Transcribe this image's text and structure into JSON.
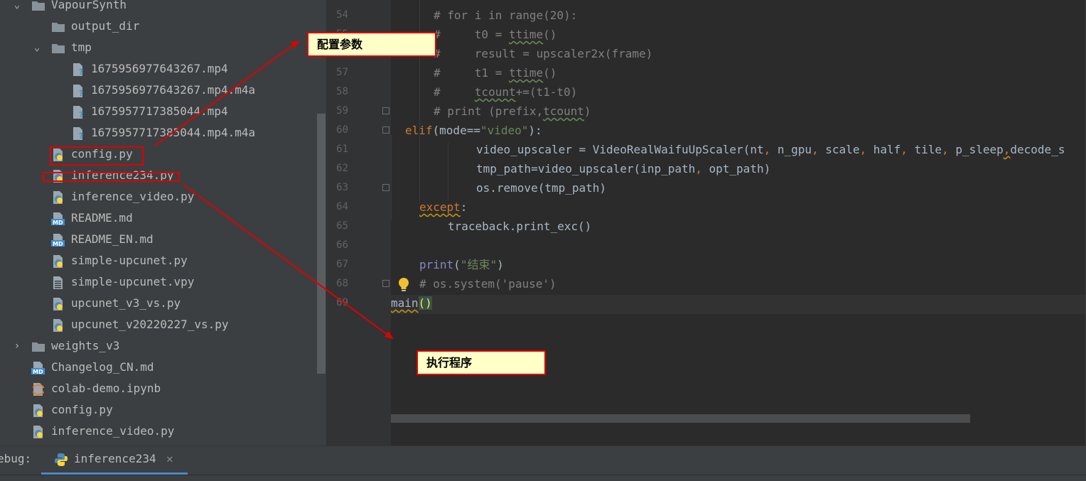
{
  "tree": {
    "rows": [
      {
        "label": "VapourSynth",
        "icon": "folder-icon",
        "arrow": "expanded"
      },
      {
        "label": "output_dir",
        "icon": "folder-icon",
        "arrow": "none"
      },
      {
        "label": "tmp",
        "icon": "folder-icon",
        "arrow": "expanded"
      },
      {
        "label": "1675956977643267.mp4",
        "icon": "unknown-file-icon",
        "arrow": "none"
      },
      {
        "label": "1675956977643267.mp4.m4a",
        "icon": "unknown-file-icon",
        "arrow": "none"
      },
      {
        "label": "1675957717385044.mp4",
        "icon": "unknown-file-icon",
        "arrow": "none"
      },
      {
        "label": "1675957717385044.mp4.m4a",
        "icon": "unknown-file-icon",
        "arrow": "none"
      },
      {
        "label": "config.py",
        "icon": "python-file-icon",
        "arrow": "none"
      },
      {
        "label": "inference234.py",
        "icon": "python-file-icon",
        "arrow": "none"
      },
      {
        "label": "inference_video.py",
        "icon": "python-file-icon",
        "arrow": "none"
      },
      {
        "label": "README.md",
        "icon": "markdown-file-icon",
        "arrow": "none"
      },
      {
        "label": "README_EN.md",
        "icon": "markdown-file-icon",
        "arrow": "none"
      },
      {
        "label": "simple-upcunet.py",
        "icon": "python-file-icon",
        "arrow": "none"
      },
      {
        "label": "simple-upcunet.vpy",
        "icon": "text-file-icon",
        "arrow": "none"
      },
      {
        "label": "upcunet_v3_vs.py",
        "icon": "python-file-icon",
        "arrow": "none"
      },
      {
        "label": "upcunet_v20220227_vs.py",
        "icon": "python-file-icon",
        "arrow": "none"
      },
      {
        "label": "weights_v3",
        "icon": "folder-icon",
        "arrow": "collapsed"
      },
      {
        "label": "Changelog_CN.md",
        "icon": "markdown-file-icon",
        "arrow": "none"
      },
      {
        "label": "colab-demo.ipynb",
        "icon": "jupyter-file-icon",
        "arrow": "none"
      },
      {
        "label": "config.py",
        "icon": "python-file-icon",
        "arrow": "none"
      },
      {
        "label": "inference_video.py",
        "icon": "python-file-icon",
        "arrow": "none"
      }
    ]
  },
  "editor": {
    "lines": [
      {
        "num": "54",
        "tokens": [
          {
            "t": "# for i in range(20):",
            "c": "comment"
          }
        ]
      },
      {
        "num": "55",
        "tokens": [
          {
            "t": "#     t0 = ",
            "c": "comment"
          },
          {
            "t": "ttime",
            "c": "comment-typo"
          },
          {
            "t": "()",
            "c": "comment"
          }
        ]
      },
      {
        "num": "56",
        "tokens": [
          {
            "t": "#     result = upscaler2x(frame)",
            "c": "comment"
          }
        ]
      },
      {
        "num": "57",
        "tokens": [
          {
            "t": "#     t1 = ",
            "c": "comment"
          },
          {
            "t": "ttime",
            "c": "comment-typo"
          },
          {
            "t": "()",
            "c": "comment"
          }
        ]
      },
      {
        "num": "58",
        "tokens": [
          {
            "t": "#     ",
            "c": "comment"
          },
          {
            "t": "tcount",
            "c": "comment-typo"
          },
          {
            "t": "+=(t1-t0)",
            "c": "comment"
          }
        ]
      },
      {
        "num": "59",
        "tokens": [
          {
            "t": "# print (prefix,",
            "c": "comment"
          },
          {
            "t": "tcount",
            "c": "comment-typo"
          },
          {
            "t": ")",
            "c": "comment"
          }
        ]
      },
      {
        "num": "60",
        "tokens": [
          {
            "t": "elif",
            "c": "kw"
          },
          {
            "t": "(mode==",
            "c": "def"
          },
          {
            "t": "\"video\"",
            "c": "str"
          },
          {
            "t": "):",
            "c": "def"
          }
        ]
      },
      {
        "num": "61",
        "tokens": [
          {
            "t": "video_upscaler = VideoRealWaifuUpScaler(nt",
            "c": "def"
          },
          {
            "t": ", ",
            "c": "kw"
          },
          {
            "t": "n_gpu",
            "c": "def"
          },
          {
            "t": ", ",
            "c": "kw"
          },
          {
            "t": "scale",
            "c": "def"
          },
          {
            "t": ", ",
            "c": "kw"
          },
          {
            "t": "half",
            "c": "def"
          },
          {
            "t": ", ",
            "c": "kw"
          },
          {
            "t": "tile",
            "c": "def"
          },
          {
            "t": ", ",
            "c": "kw"
          },
          {
            "t": "p_sleep",
            "c": "def"
          },
          {
            "t": ",",
            "c": "kw-warn"
          },
          {
            "t": "decode_s",
            "c": "def"
          }
        ]
      },
      {
        "num": "62",
        "tokens": [
          {
            "t": "tmp_path=video_upscaler(inp_path",
            "c": "def"
          },
          {
            "t": ", ",
            "c": "kw"
          },
          {
            "t": "opt_path)",
            "c": "def"
          }
        ]
      },
      {
        "num": "63",
        "tokens": [
          {
            "t": "os.remove(tmp_path)",
            "c": "def"
          }
        ]
      },
      {
        "num": "64",
        "tokens": [
          {
            "t": "except",
            "c": "kw-warn"
          },
          {
            "t": ":",
            "c": "def"
          }
        ]
      },
      {
        "num": "65",
        "tokens": [
          {
            "t": "traceback.print_exc()",
            "c": "def"
          }
        ]
      },
      {
        "num": "66",
        "tokens": []
      },
      {
        "num": "67",
        "tokens": [
          {
            "t": "print",
            "c": "builtin"
          },
          {
            "t": "(",
            "c": "def"
          },
          {
            "t": "\"结束\"",
            "c": "str"
          },
          {
            "t": ")",
            "c": "def"
          }
        ]
      },
      {
        "num": "68",
        "tokens": [
          {
            "t": "# os.system('pause')",
            "c": "comment"
          }
        ]
      },
      {
        "num": "69",
        "tokens": [
          {
            "t": "main",
            "c": "def-warn"
          },
          {
            "t": "()",
            "c": "paren-match"
          }
        ]
      }
    ]
  },
  "debug_bar": {
    "label": "ebug:",
    "tab_label": "inference234",
    "close_symbol": "✕"
  },
  "annotations": {
    "config_callout": "配置参数",
    "run_callout": "执行程序"
  },
  "colors": {
    "comment": "#808080",
    "keyword": "#cc7832",
    "string": "#6a8759",
    "builtin": "#8888c6",
    "default": "#a9b7c6",
    "annotation_red": "#e00000",
    "callout_fill": "#ffffc8"
  }
}
